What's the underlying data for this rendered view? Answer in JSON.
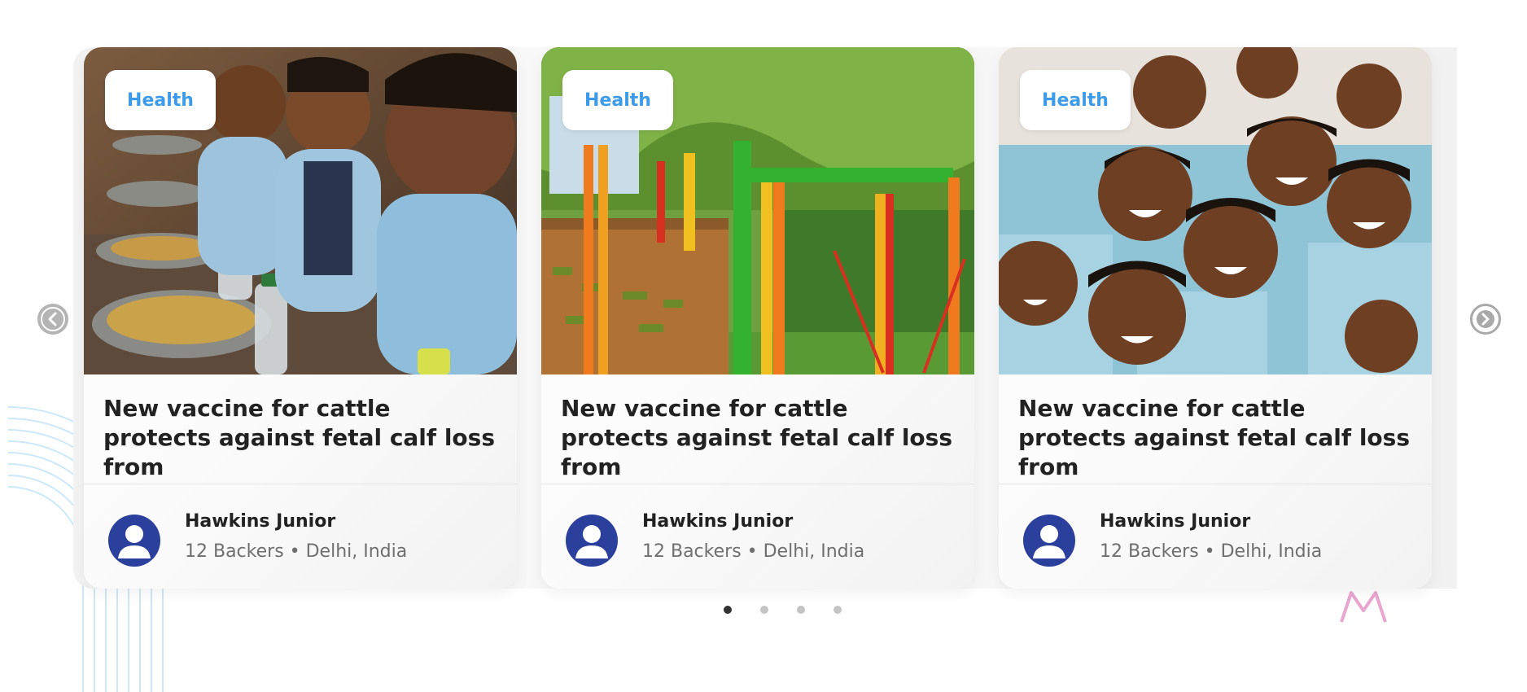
{
  "colors": {
    "accent": "#3d9be9",
    "avatar": "#2b3f9d",
    "dot_active": "#333333",
    "dot_inactive": "#c4c4c4",
    "arc": "#cde8f8",
    "star": "#e9a6cf"
  },
  "carousel": {
    "prev_icon": "chevron-left-icon",
    "next_icon": "chevron-right-icon",
    "active_index": 0,
    "dot_count": 4
  },
  "cards": [
    {
      "category": "Health",
      "title": "New vaccine for cattle protects against fetal calf loss from",
      "author": "Hawkins Junior",
      "meta": "12 Backers • Delhi, India",
      "image_icon": "children-eating-meal-photo"
    },
    {
      "category": "Health",
      "title": "New vaccine for cattle protects against fetal calf loss from",
      "author": "Hawkins Junior",
      "meta": "12 Backers • Delhi, India",
      "image_icon": "colorful-playground-photo"
    },
    {
      "category": "Health",
      "title": "New vaccine for cattle protects against fetal calf loss from",
      "author": "Hawkins Junior",
      "meta": "12 Backers • Delhi, India",
      "image_icon": "group-of-smiling-kids-photo"
    }
  ]
}
